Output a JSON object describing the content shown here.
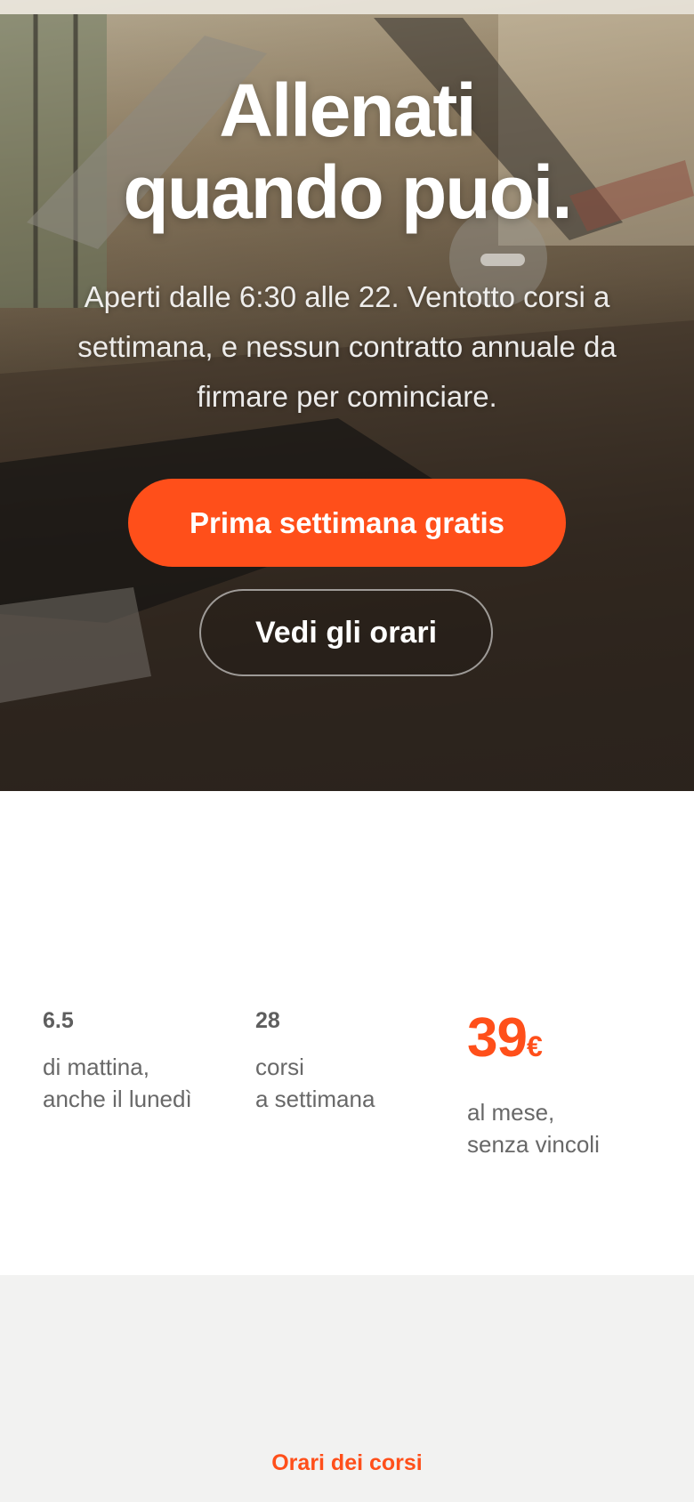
{
  "hero": {
    "title_line1": "Allenati",
    "title_line2": "quando puoi.",
    "subtitle": "Aperti dalle 6:30 alle 22. Ventotto corsi a settimana, e nessun contratto annuale da firmare per cominciare.",
    "primary_button": "Prima settimana gratis",
    "secondary_button": "Vedi gli orari"
  },
  "stats": [
    {
      "value": "6.5",
      "desc_line1": "di mattina,",
      "desc_line2": "anche il lunedì"
    },
    {
      "value": "28",
      "desc_line1": "corsi",
      "desc_line2": "a settimana"
    },
    {
      "value": "39",
      "currency": "€",
      "desc_line1": "al mese,",
      "desc_line2": "senza vincoli"
    }
  ],
  "schedule": {
    "title": "Orari dei corsi"
  },
  "colors": {
    "accent": "#ff4f1a",
    "text_muted": "#686868",
    "section_bg": "#f2f2f1"
  }
}
